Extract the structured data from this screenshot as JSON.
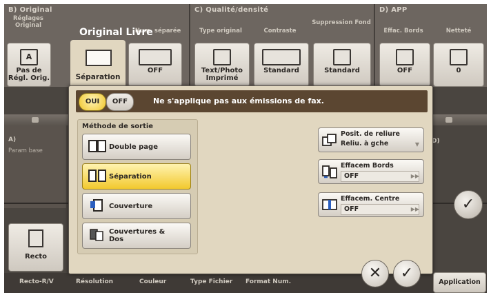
{
  "sections": {
    "original": {
      "header": "B)   Original",
      "col1_label": "Réglages Original",
      "col2_label": "Num. séparée",
      "btn1_label": "Pas de Régl. Orig.",
      "btn1_icon": "A",
      "btn3_label": "OFF"
    },
    "quality": {
      "header": "C)   Qualité/densité",
      "col1_label": "Type original",
      "col2_label": "Contraste",
      "col3_label": "Suppression Fond",
      "btn1_label": "Text/Photo Imprimé",
      "btn2_label": "Standard",
      "btn3_label": "Standard"
    },
    "app": {
      "header": "D)   APP",
      "col1_label": "Effac. Bords",
      "col2_label": "Netteté",
      "btn1_label": "OFF",
      "btn2_label": "0"
    }
  },
  "left_panel": {
    "title": "A)",
    "subtitle": "Param base",
    "recto_label": "Recto",
    "right_label": "D)"
  },
  "bottom_tabs": [
    "Recto-R/V",
    "Résolution",
    "Couleur",
    "Type Fichier",
    "Format Num."
  ],
  "application_button": "Application",
  "popup": {
    "title": "Original Livre",
    "tab_label": "Séparation",
    "toggle_on": "OUI",
    "toggle_off": "OFF",
    "message": "Ne s'applique pas aux émissions de fax.",
    "method_label": "Méthode de sortie",
    "methods": [
      {
        "label": "Double page",
        "icon": "open-book-icon",
        "selected": false
      },
      {
        "label": "Séparation",
        "icon": "separated-pages-icon",
        "selected": true
      },
      {
        "label": "Couverture",
        "icon": "cover-icon",
        "selected": false
      },
      {
        "label": "Couvertures &\nDos",
        "icon": "covers-back-icon",
        "selected": false
      }
    ],
    "binding": {
      "title": "Posit. de reliure",
      "value": "Reliu. à gche"
    },
    "edge_erase": {
      "title": "Effacem Bords",
      "value": "OFF"
    },
    "center_erase": {
      "title": "Effacem. Centre",
      "value": "OFF"
    },
    "cancel_symbol": "✕",
    "ok_symbol": "✓"
  },
  "right_check_symbol": "✓",
  "colors": {
    "selected": "#f2c92e",
    "header": "#5b4631",
    "popup_bg": "#e1d7c0"
  }
}
